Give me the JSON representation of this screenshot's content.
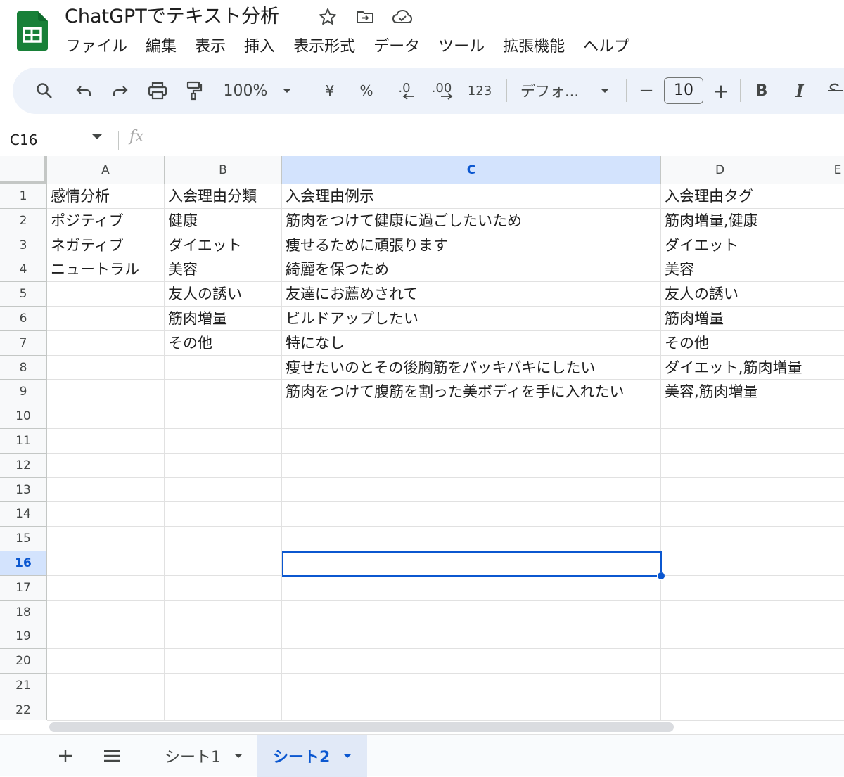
{
  "app": {
    "doc_title": "ChatGPTでテキスト分析",
    "icons": [
      "sheets-logo",
      "star-icon",
      "move-folder-icon",
      "cloud-status-icon"
    ]
  },
  "menubar": [
    "ファイル",
    "編集",
    "表示",
    "挿入",
    "表示形式",
    "データ",
    "ツール",
    "拡張機能",
    "ヘルプ"
  ],
  "toolbar": {
    "zoom": "100%",
    "currency": "¥",
    "percent": "%",
    "decrease_decimal": ".0",
    "increase_decimal": ".00",
    "number_format": "123",
    "font": "デフォ...",
    "font_size": "10",
    "minus": "−",
    "plus": "+",
    "bold": "B",
    "italic": "I"
  },
  "formula_bar": {
    "name_box": "C16",
    "fx": "fx",
    "value": ""
  },
  "columns": [
    "A",
    "B",
    "C",
    "D",
    "E"
  ],
  "selected_column": "C",
  "selected_row": "16",
  "rows": [
    "1",
    "2",
    "3",
    "4",
    "5",
    "6",
    "7",
    "8",
    "9",
    "10",
    "11",
    "12",
    "13",
    "14",
    "15",
    "16",
    "17",
    "18",
    "19",
    "20",
    "21",
    "22"
  ],
  "cells": [
    [
      "感情分析",
      "入会理由分類",
      "入会理由例示",
      "入会理由タグ"
    ],
    [
      "ポジティブ",
      "健康",
      "筋肉をつけて健康に過ごしたいため",
      "筋肉増量,健康"
    ],
    [
      "ネガティブ",
      "ダイエット",
      "痩せるために頑張ります",
      "ダイエット"
    ],
    [
      "ニュートラル",
      "美容",
      "綺麗を保つため",
      "美容"
    ],
    [
      "",
      "友人の誘い",
      "友達にお薦めされて",
      "友人の誘い"
    ],
    [
      "",
      "筋肉増量",
      "ビルドアップしたい",
      "筋肉増量"
    ],
    [
      "",
      "その他",
      "特になし",
      "その他"
    ],
    [
      "",
      "",
      "痩せたいのとその後胸筋をバッキバキにしたい",
      "ダイエット,筋肉増量"
    ],
    [
      "",
      "",
      "筋肉をつけて腹筋を割った美ボディを手に入れたい",
      "美容,筋肉増量"
    ]
  ],
  "sheet_tabs": [
    {
      "label": "シート1",
      "active": false
    },
    {
      "label": "シート2",
      "active": true
    }
  ],
  "colors": {
    "accent": "#0b57d0",
    "toolbar_bg": "#edf2fa",
    "header_selected": "#d3e3fd",
    "logo_green": "#188038"
  }
}
